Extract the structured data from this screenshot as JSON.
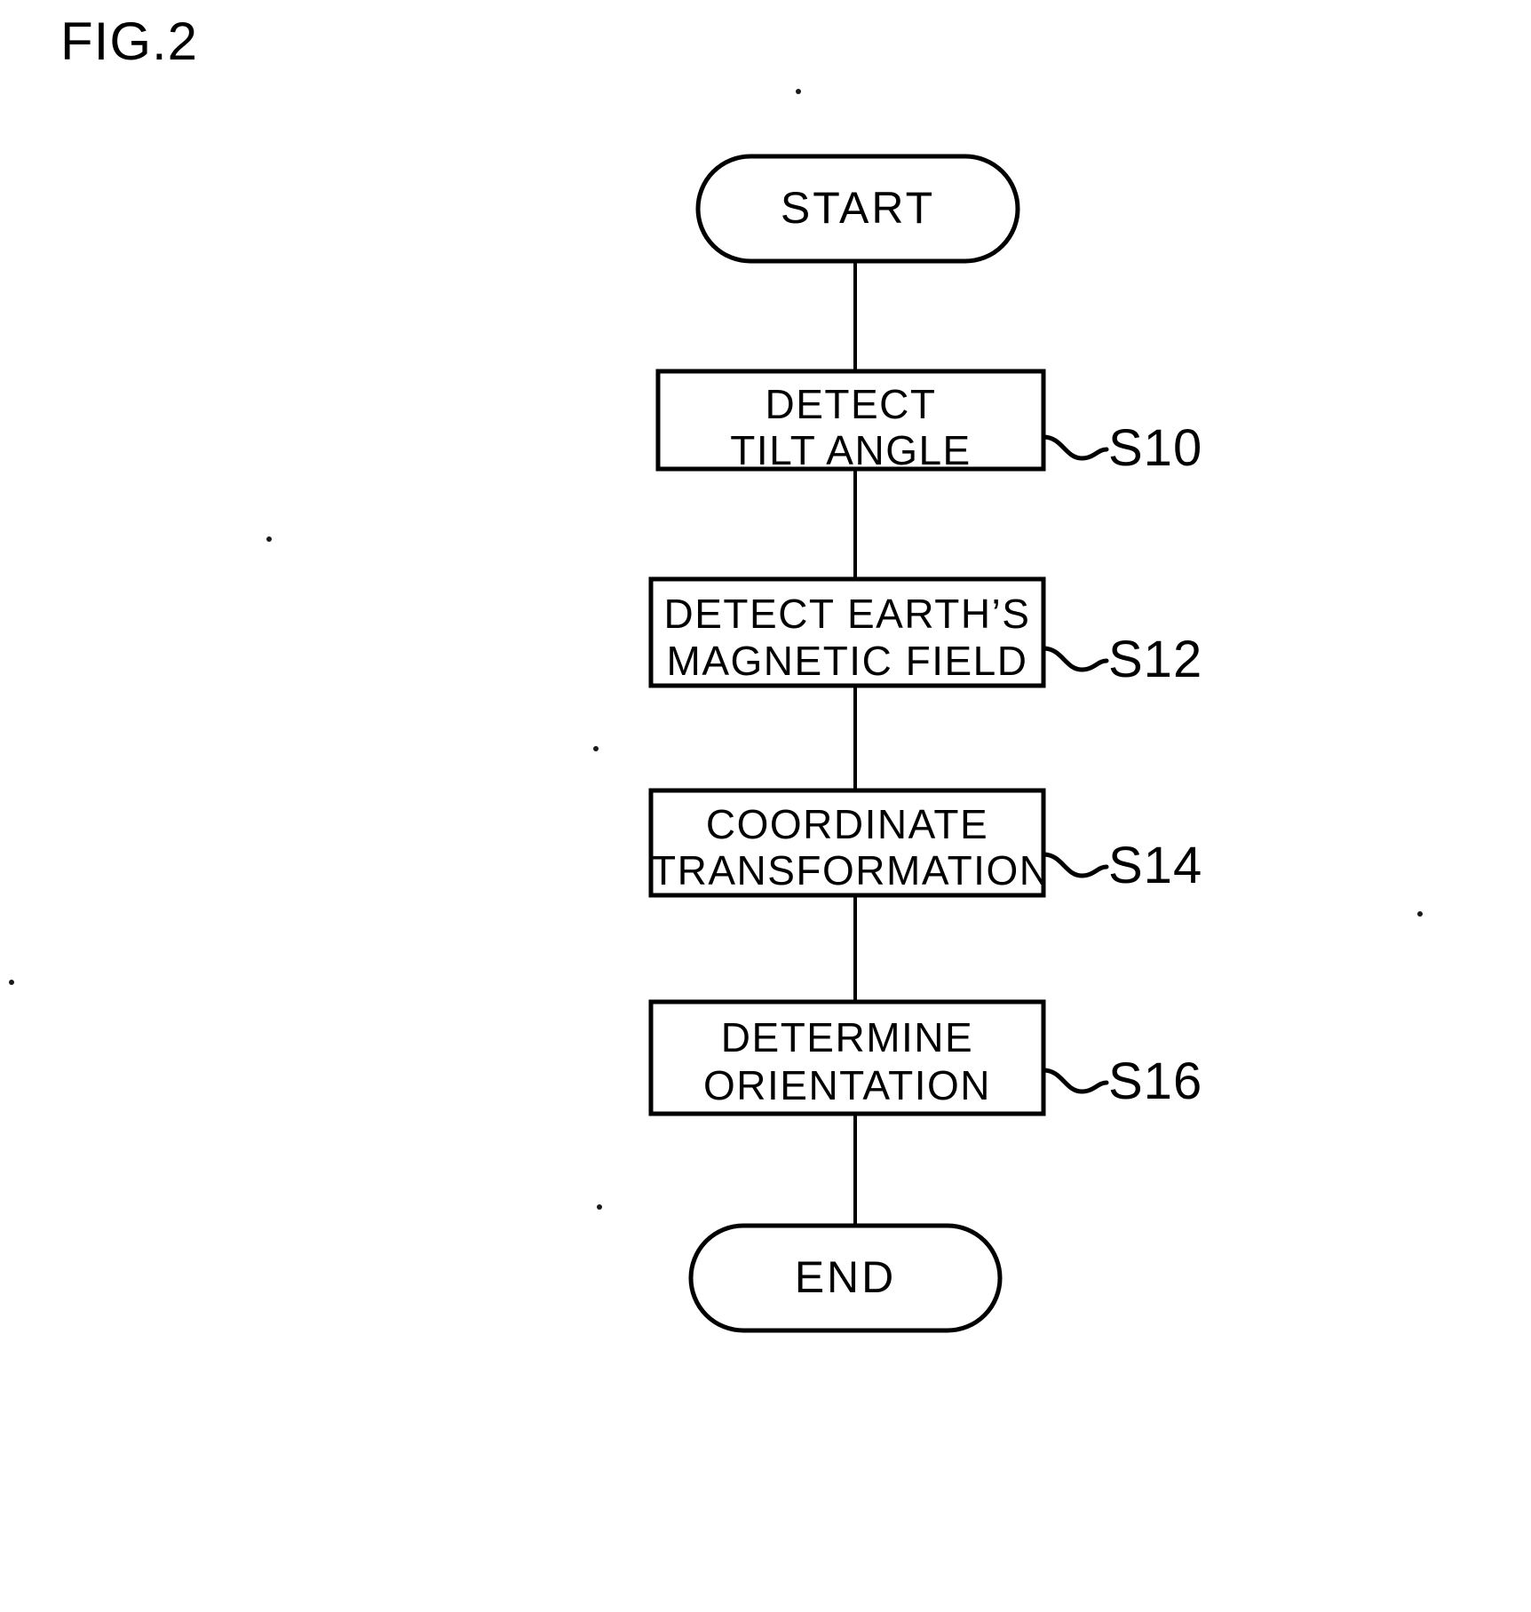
{
  "figure": {
    "title": "FIG.2",
    "type": "flowchart",
    "orientation": "vertical",
    "stroke_color": "#000000",
    "background_color": "#ffffff"
  },
  "nodes": [
    {
      "id": "start",
      "shape": "terminal",
      "label": "START",
      "lines": [
        "START"
      ],
      "step_ref": null
    },
    {
      "id": "s10",
      "shape": "process",
      "label": "DETECT TILT ANGLE",
      "lines": [
        "DETECT",
        "TILT ANGLE"
      ],
      "step_ref": "S10"
    },
    {
      "id": "s12",
      "shape": "process",
      "label": "DETECT EARTH'S MAGNETIC FIELD",
      "lines": [
        "DETECT EARTH’S",
        "MAGNETIC FIELD"
      ],
      "step_ref": "S12"
    },
    {
      "id": "s14",
      "shape": "process",
      "label": "COORDINATE TRANSFORMATION",
      "lines": [
        "COORDINATE",
        "TRANSFORMATION"
      ],
      "step_ref": "S14"
    },
    {
      "id": "s16",
      "shape": "process",
      "label": "DETERMINE ORIENTATION",
      "lines": [
        "DETERMINE",
        "ORIENTATION"
      ],
      "step_ref": "S16"
    },
    {
      "id": "end",
      "shape": "terminal",
      "label": "END",
      "lines": [
        "END"
      ],
      "step_ref": null
    }
  ],
  "edges": [
    {
      "from": "start",
      "to": "s10"
    },
    {
      "from": "s10",
      "to": "s12"
    },
    {
      "from": "s12",
      "to": "s14"
    },
    {
      "from": "s14",
      "to": "s16"
    },
    {
      "from": "s16",
      "to": "end"
    }
  ],
  "text": {
    "start": "START",
    "end": "END",
    "s10_line1": "DETECT",
    "s10_line2": "TILT ANGLE",
    "s12_line1": "DETECT EARTH’S",
    "s12_line2": "MAGNETIC FIELD",
    "s14_line1": "COORDINATE",
    "s14_line2": "TRANSFORMATION",
    "s16_line1": "DETERMINE",
    "s16_line2": "ORIENTATION",
    "ref_s10": "S10",
    "ref_s12": "S12",
    "ref_s14": "S14",
    "ref_s16": "S16"
  }
}
